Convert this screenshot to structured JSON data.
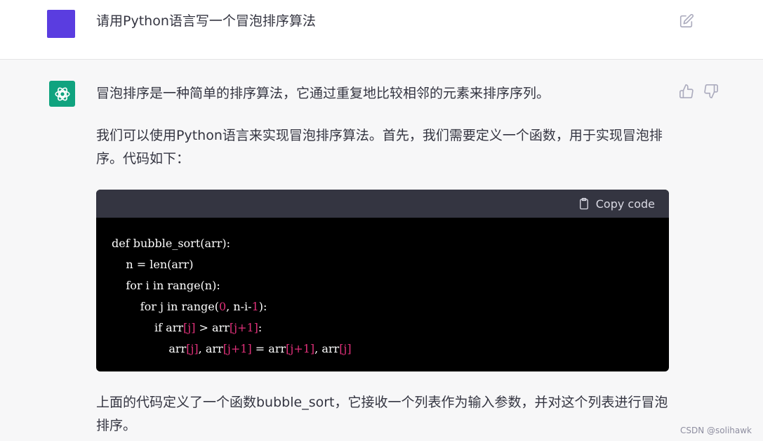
{
  "user": {
    "message": "请用Python语言写一个冒泡排序算法",
    "avatar_color": "#5a3de0",
    "edit_icon": "edit-icon"
  },
  "assistant": {
    "avatar_color": "#10a37f",
    "avatar_icon": "openai-logo-icon",
    "paragraph1": "冒泡排序是一种简单的排序算法，它通过重复地比较相邻的元素来排序序列。",
    "paragraph2": "我们可以使用Python语言来实现冒泡排序算法。首先，我们需要定义一个函数，用于实现冒泡排序。代码如下：",
    "paragraph3": "上面的代码定义了一个函数bubble_sort，它接收一个列表作为输入参数，并对这个列表进行冒泡排序。",
    "feedback_icons": [
      "thumbs-up-icon",
      "thumbs-down-icon"
    ]
  },
  "code": {
    "copy_label": "Copy code",
    "line1": "def bubble_sort(arr):",
    "line2": "    n = len(arr)",
    "line3": "    for i in range(n):",
    "line4a": "        for j in range(",
    "line4b": "0",
    "line4c": ", n-i-",
    "line4d": "1",
    "line4e": "):",
    "line5a": "            if arr",
    "line5b": "[j]",
    "line5c": " > arr",
    "line5d": "[j+1]",
    "line5e": ":",
    "line6a": "                arr",
    "line6b": "[j]",
    "line6c": ", arr",
    "line6d": "[j+1]",
    "line6e": " = arr",
    "line6f": "[j+1]",
    "line6g": ", arr",
    "line6h": "[j]"
  },
  "watermark": "CSDN @solihawk"
}
